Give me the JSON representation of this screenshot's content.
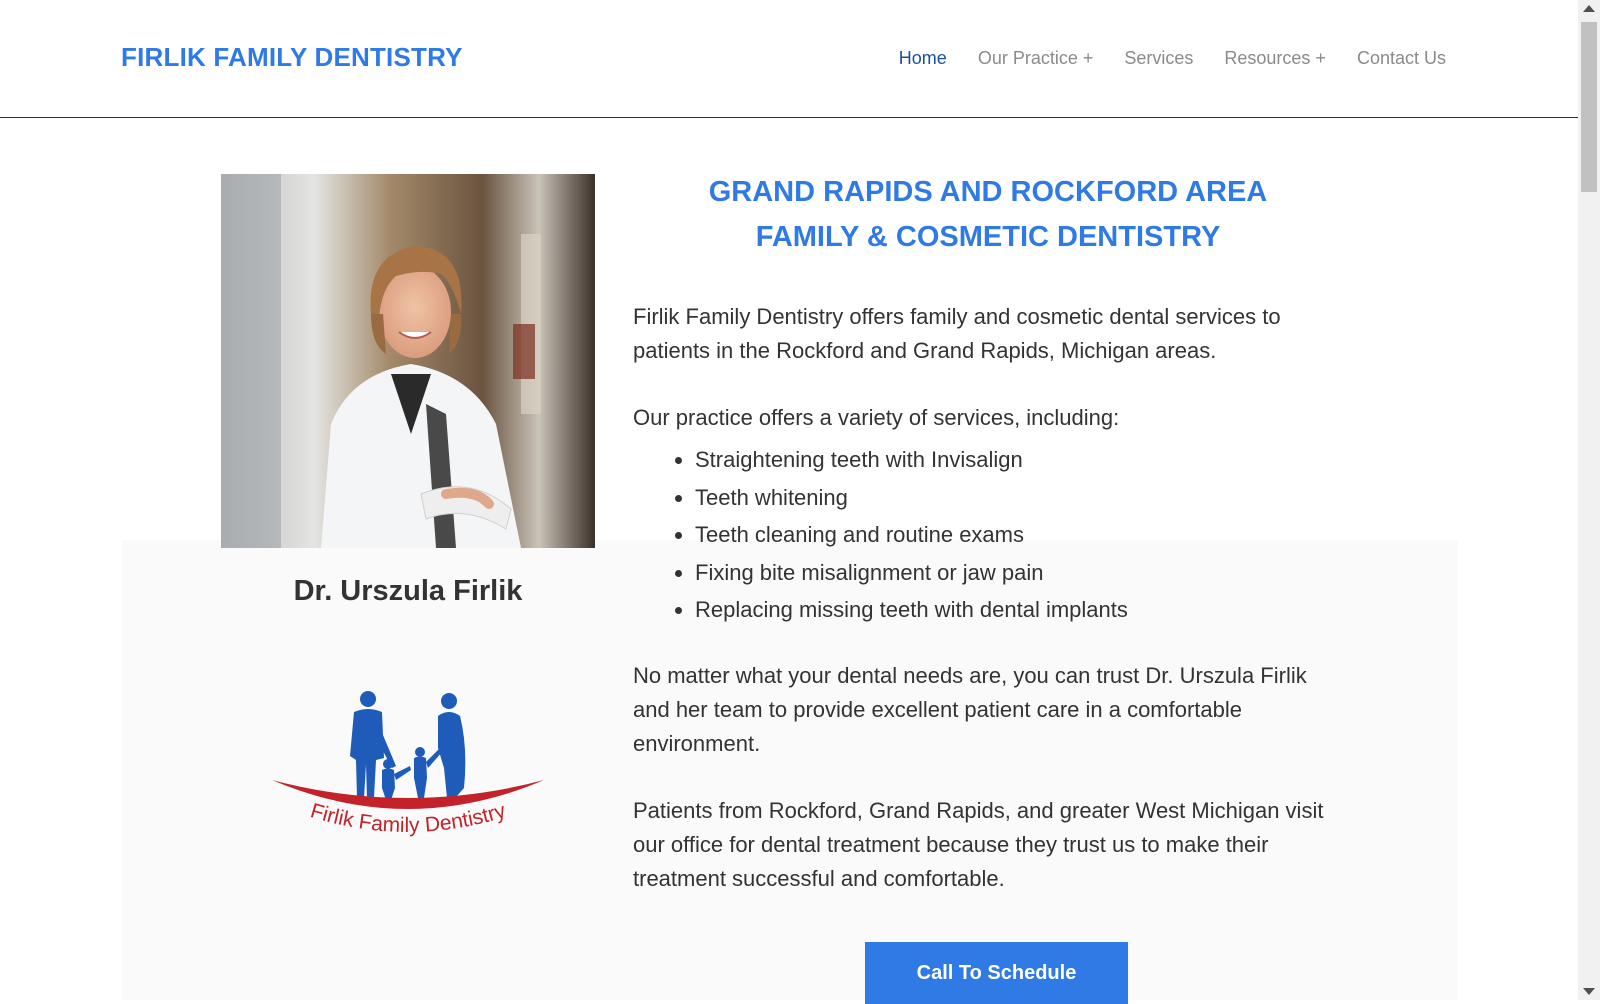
{
  "header": {
    "site_title": "FIRLIK FAMILY DENTISTRY",
    "nav": [
      {
        "label": "Home",
        "active": true
      },
      {
        "label": "Our Practice +",
        "active": false
      },
      {
        "label": "Services",
        "active": false
      },
      {
        "label": "Resources +",
        "active": false
      },
      {
        "label": "Contact Us",
        "active": false
      }
    ]
  },
  "sidebar": {
    "doctor_name": "Dr. Urszula Firlik",
    "logo_text": "Firlik Family Dentistry"
  },
  "main": {
    "headline_line1": "GRAND RAPIDS AND ROCKFORD AREA",
    "headline_line2": "FAMILY & COSMETIC DENTISTRY",
    "intro": "Firlik Family Dentistry offers family and cosmetic dental services to patients in the Rockford and Grand Rapids, Michigan areas.",
    "services_intro": "Our practice offers a variety of services, including:",
    "services": [
      "Straightening teeth with Invisalign",
      "Teeth whitening",
      "Teeth cleaning and routine exams",
      "Fixing bite misalignment or jaw pain",
      "Replacing missing teeth with dental implants"
    ],
    "trust_text": "No matter what your dental needs are, you can trust Dr. Urszula Firlik and her team to provide excellent patient care in a comfortable environment.",
    "patients_text": "Patients from Rockford, Grand Rapids, and greater West Michigan visit our office for dental treatment because they trust us to make their treatment successful and comfortable.",
    "cta_label": "Call To Schedule"
  },
  "colors": {
    "brand_blue": "#2f7ae5",
    "logo_blue": "#1f5bb8",
    "logo_red": "#c4222a",
    "nav_active": "#1a4f9c",
    "nav_inactive": "#8a8a8a",
    "text": "#333333"
  }
}
